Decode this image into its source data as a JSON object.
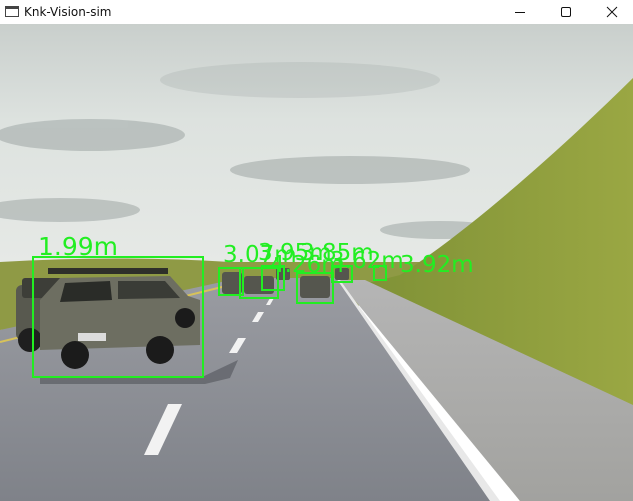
{
  "window": {
    "title": "Knk-Vision-sim",
    "controls": [
      "minimize",
      "maximize",
      "close"
    ]
  },
  "colors": {
    "detection": "#22ee22",
    "sky": "#d8dedd",
    "road": "#8a8d94",
    "grass": "#8a9a3a"
  },
  "detections": [
    {
      "label": "1.99m"
    },
    {
      "label": "3.07m"
    },
    {
      "label": "3.95m"
    },
    {
      "label": "3.85m"
    },
    {
      "label": "3.62m"
    },
    {
      "label": "4.26m"
    },
    {
      "label": "3.92m"
    }
  ]
}
